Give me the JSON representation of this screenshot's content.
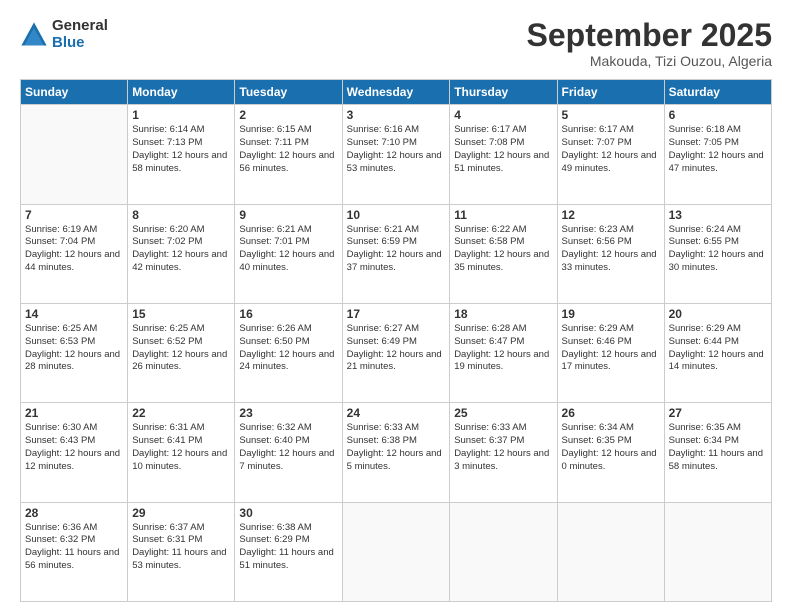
{
  "header": {
    "logo_general": "General",
    "logo_blue": "Blue",
    "month_title": "September 2025",
    "location": "Makouda, Tizi Ouzou, Algeria"
  },
  "weekdays": [
    "Sunday",
    "Monday",
    "Tuesday",
    "Wednesday",
    "Thursday",
    "Friday",
    "Saturday"
  ],
  "weeks": [
    [
      {
        "day": "",
        "detail": ""
      },
      {
        "day": "1",
        "detail": "Sunrise: 6:14 AM\nSunset: 7:13 PM\nDaylight: 12 hours\nand 58 minutes."
      },
      {
        "day": "2",
        "detail": "Sunrise: 6:15 AM\nSunset: 7:11 PM\nDaylight: 12 hours\nand 56 minutes."
      },
      {
        "day": "3",
        "detail": "Sunrise: 6:16 AM\nSunset: 7:10 PM\nDaylight: 12 hours\nand 53 minutes."
      },
      {
        "day": "4",
        "detail": "Sunrise: 6:17 AM\nSunset: 7:08 PM\nDaylight: 12 hours\nand 51 minutes."
      },
      {
        "day": "5",
        "detail": "Sunrise: 6:17 AM\nSunset: 7:07 PM\nDaylight: 12 hours\nand 49 minutes."
      },
      {
        "day": "6",
        "detail": "Sunrise: 6:18 AM\nSunset: 7:05 PM\nDaylight: 12 hours\nand 47 minutes."
      }
    ],
    [
      {
        "day": "7",
        "detail": "Sunrise: 6:19 AM\nSunset: 7:04 PM\nDaylight: 12 hours\nand 44 minutes."
      },
      {
        "day": "8",
        "detail": "Sunrise: 6:20 AM\nSunset: 7:02 PM\nDaylight: 12 hours\nand 42 minutes."
      },
      {
        "day": "9",
        "detail": "Sunrise: 6:21 AM\nSunset: 7:01 PM\nDaylight: 12 hours\nand 40 minutes."
      },
      {
        "day": "10",
        "detail": "Sunrise: 6:21 AM\nSunset: 6:59 PM\nDaylight: 12 hours\nand 37 minutes."
      },
      {
        "day": "11",
        "detail": "Sunrise: 6:22 AM\nSunset: 6:58 PM\nDaylight: 12 hours\nand 35 minutes."
      },
      {
        "day": "12",
        "detail": "Sunrise: 6:23 AM\nSunset: 6:56 PM\nDaylight: 12 hours\nand 33 minutes."
      },
      {
        "day": "13",
        "detail": "Sunrise: 6:24 AM\nSunset: 6:55 PM\nDaylight: 12 hours\nand 30 minutes."
      }
    ],
    [
      {
        "day": "14",
        "detail": "Sunrise: 6:25 AM\nSunset: 6:53 PM\nDaylight: 12 hours\nand 28 minutes."
      },
      {
        "day": "15",
        "detail": "Sunrise: 6:25 AM\nSunset: 6:52 PM\nDaylight: 12 hours\nand 26 minutes."
      },
      {
        "day": "16",
        "detail": "Sunrise: 6:26 AM\nSunset: 6:50 PM\nDaylight: 12 hours\nand 24 minutes."
      },
      {
        "day": "17",
        "detail": "Sunrise: 6:27 AM\nSunset: 6:49 PM\nDaylight: 12 hours\nand 21 minutes."
      },
      {
        "day": "18",
        "detail": "Sunrise: 6:28 AM\nSunset: 6:47 PM\nDaylight: 12 hours\nand 19 minutes."
      },
      {
        "day": "19",
        "detail": "Sunrise: 6:29 AM\nSunset: 6:46 PM\nDaylight: 12 hours\nand 17 minutes."
      },
      {
        "day": "20",
        "detail": "Sunrise: 6:29 AM\nSunset: 6:44 PM\nDaylight: 12 hours\nand 14 minutes."
      }
    ],
    [
      {
        "day": "21",
        "detail": "Sunrise: 6:30 AM\nSunset: 6:43 PM\nDaylight: 12 hours\nand 12 minutes."
      },
      {
        "day": "22",
        "detail": "Sunrise: 6:31 AM\nSunset: 6:41 PM\nDaylight: 12 hours\nand 10 minutes."
      },
      {
        "day": "23",
        "detail": "Sunrise: 6:32 AM\nSunset: 6:40 PM\nDaylight: 12 hours\nand 7 minutes."
      },
      {
        "day": "24",
        "detail": "Sunrise: 6:33 AM\nSunset: 6:38 PM\nDaylight: 12 hours\nand 5 minutes."
      },
      {
        "day": "25",
        "detail": "Sunrise: 6:33 AM\nSunset: 6:37 PM\nDaylight: 12 hours\nand 3 minutes."
      },
      {
        "day": "26",
        "detail": "Sunrise: 6:34 AM\nSunset: 6:35 PM\nDaylight: 12 hours\nand 0 minutes."
      },
      {
        "day": "27",
        "detail": "Sunrise: 6:35 AM\nSunset: 6:34 PM\nDaylight: 11 hours\nand 58 minutes."
      }
    ],
    [
      {
        "day": "28",
        "detail": "Sunrise: 6:36 AM\nSunset: 6:32 PM\nDaylight: 11 hours\nand 56 minutes."
      },
      {
        "day": "29",
        "detail": "Sunrise: 6:37 AM\nSunset: 6:31 PM\nDaylight: 11 hours\nand 53 minutes."
      },
      {
        "day": "30",
        "detail": "Sunrise: 6:38 AM\nSunset: 6:29 PM\nDaylight: 11 hours\nand 51 minutes."
      },
      {
        "day": "",
        "detail": ""
      },
      {
        "day": "",
        "detail": ""
      },
      {
        "day": "",
        "detail": ""
      },
      {
        "day": "",
        "detail": ""
      }
    ]
  ]
}
